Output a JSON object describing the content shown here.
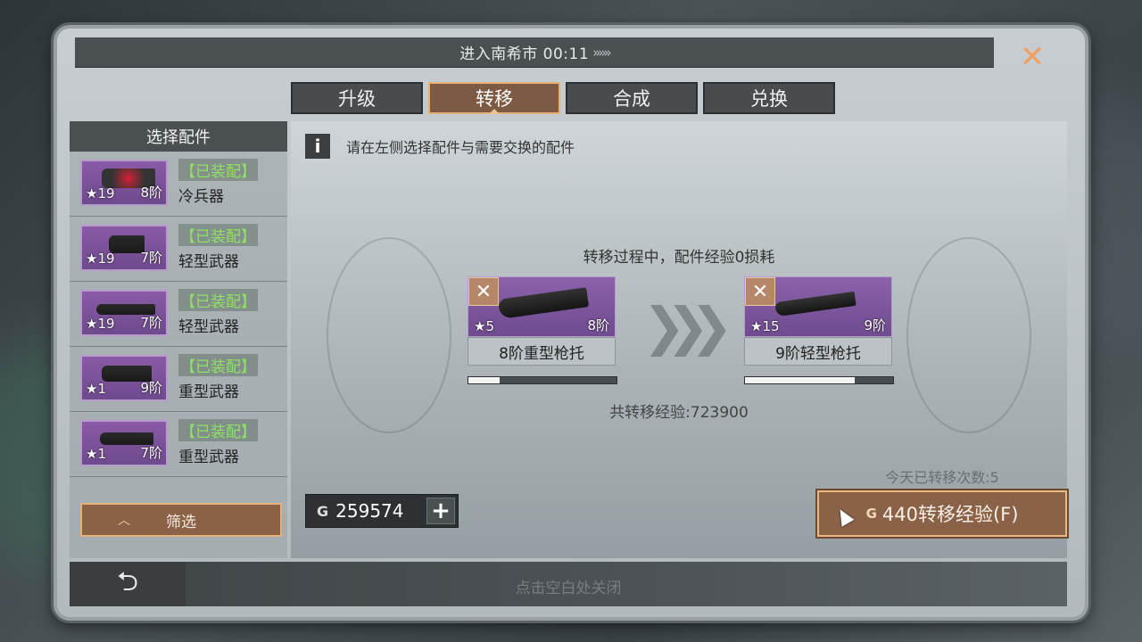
{
  "header": {
    "title": "进入南希市 00:11",
    "title_chevrons": "»»»",
    "close_icon": "close-x-icon"
  },
  "tabs": [
    {
      "label": "升级",
      "active": false
    },
    {
      "label": "转移",
      "active": true
    },
    {
      "label": "合成",
      "active": false
    },
    {
      "label": "兑换",
      "active": false
    }
  ],
  "left": {
    "header": "选择配件",
    "items": [
      {
        "stars": "★19",
        "tier": "8阶",
        "status": "【已装配】",
        "name": "冷兵器"
      },
      {
        "stars": "★19",
        "tier": "7阶",
        "status": "【已装配】",
        "name": "轻型武器"
      },
      {
        "stars": "★19",
        "tier": "7阶",
        "status": "【已装配】",
        "name": "轻型武器"
      },
      {
        "stars": "★1",
        "tier": "9阶",
        "status": "【已装配】",
        "name": "重型武器"
      },
      {
        "stars": "★1",
        "tier": "7阶",
        "status": "【已装配】",
        "name": "重型武器"
      }
    ],
    "filter_label": "筛选"
  },
  "main": {
    "info_icon": "i",
    "info_text": "请在左侧选择配件与需要交换的配件",
    "process_text": "转移过程中，配件经验0损耗",
    "source": {
      "stars": "★5",
      "tier": "8阶",
      "label": "8阶重型枪托",
      "progress": 0.21,
      "remove_icon": "✕"
    },
    "target": {
      "stars": "★15",
      "tier": "9阶",
      "label": "9阶轻型枪托",
      "progress": 0.74,
      "remove_icon": "✕"
    },
    "arrows": "❯❯❯",
    "total_exp": "共转移经验:723900",
    "currency_symbol": "G",
    "currency_amount": "259574",
    "plus_icon": "+",
    "today_count": "今天已转移次数:5",
    "transfer_symbol": "G",
    "transfer_label": "440转移经验(F)"
  },
  "footer": {
    "back_icon": "⮌",
    "close_hint": "点击空白处关闭"
  },
  "colors": {
    "accent": "#8a6248",
    "accent_border": "#e6b07a",
    "equipped_green": "#8fe06a",
    "rarity_purple": "#7d55a0"
  }
}
